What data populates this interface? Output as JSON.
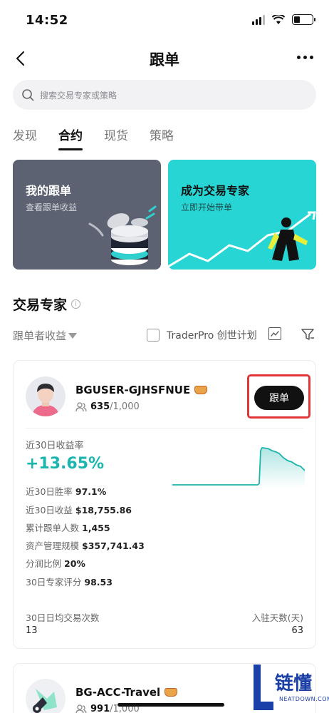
{
  "status_bar": {
    "time": "14:52"
  },
  "nav": {
    "title": "跟单"
  },
  "search": {
    "placeholder": "搜索交易专家或策略"
  },
  "tabs": [
    {
      "label": "发现",
      "active": false
    },
    {
      "label": "合约",
      "active": true
    },
    {
      "label": "现货",
      "active": false
    },
    {
      "label": "策略",
      "active": false
    }
  ],
  "promo_cards": [
    {
      "title": "我的跟单",
      "subtitle": "查看跟单收益"
    },
    {
      "title": "成为交易专家",
      "subtitle": "立即开始带单"
    }
  ],
  "section": {
    "title": "交易专家",
    "sort_label": "跟单者收益",
    "checkbox_label": "TraderPro 创世计划"
  },
  "traders": [
    {
      "name": "BGUSER-GJHSFNUE",
      "followers": "635",
      "followers_max": "/1,000",
      "follow_label": "跟单",
      "roi_label": "近30日收益率",
      "roi_value": "+13.65%",
      "stats": [
        {
          "label": "近30日胜率",
          "value": "97.1%"
        },
        {
          "label": "近30日收益",
          "value": "$18,755.86"
        },
        {
          "label": "累计跟单人数",
          "value": "1,455"
        },
        {
          "label": "资产管理规模",
          "value": "$357,741.43"
        },
        {
          "label": "分润比例",
          "value": "20%"
        },
        {
          "label": "30日专家评分",
          "value": "98.53"
        }
      ],
      "bottom": [
        {
          "label": "30日日均交易次数",
          "value": "13"
        },
        {
          "label": "入驻天数(天)",
          "value": "63"
        }
      ]
    },
    {
      "name": "BG-ACC-Travel",
      "followers": "991",
      "followers_max": "/1,000"
    }
  ],
  "watermark": {
    "text": "链懂",
    "sub": "NEATDOWN.COM"
  },
  "colors": {
    "accent": "#1ab5ad",
    "highlight": "#e0353b",
    "promo_teal": "#27d6d4",
    "promo_dark": "#5c6271"
  }
}
